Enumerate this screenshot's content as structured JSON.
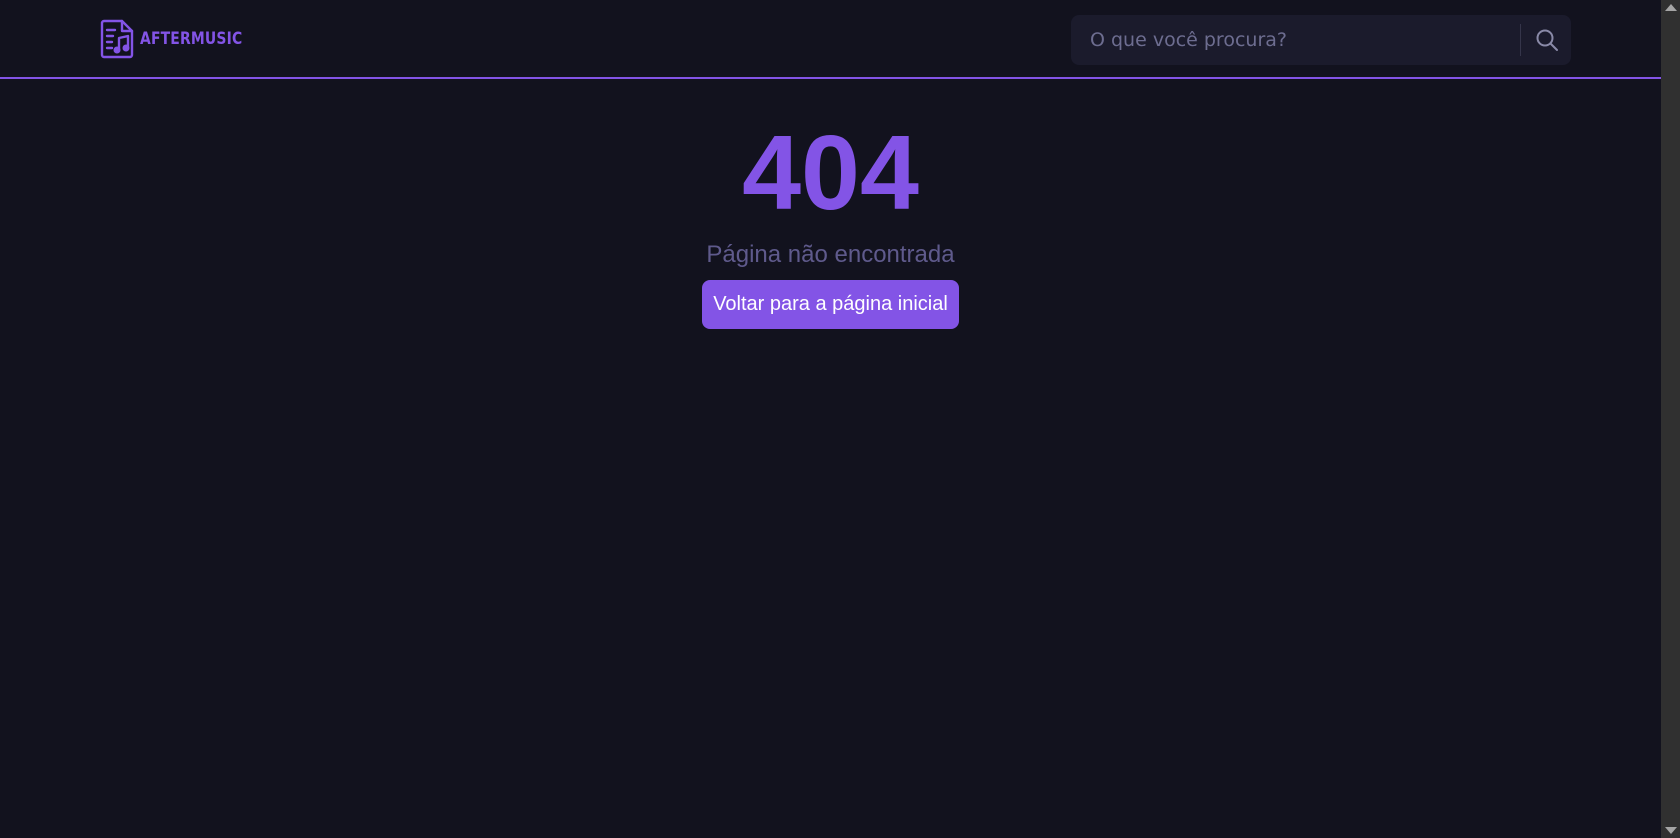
{
  "header": {
    "logo_text": "AFTERMUSIC",
    "search": {
      "placeholder": "O que você procura?",
      "value": ""
    },
    "search_button_icon": "search-icon"
  },
  "main": {
    "error_code": "404",
    "error_message": "Página não encontrada",
    "home_button_label": "Voltar para a página inicial"
  },
  "colors": {
    "background": "#12121e",
    "accent": "#8354e6",
    "search_background": "#1b1b2c",
    "muted_text": "#5f5a8c"
  },
  "icons": {
    "logo": "music-file-icon",
    "search": "search-icon",
    "scroll_up": "scroll-up-arrow-icon",
    "scroll_down": "scroll-down-arrow-icon"
  }
}
